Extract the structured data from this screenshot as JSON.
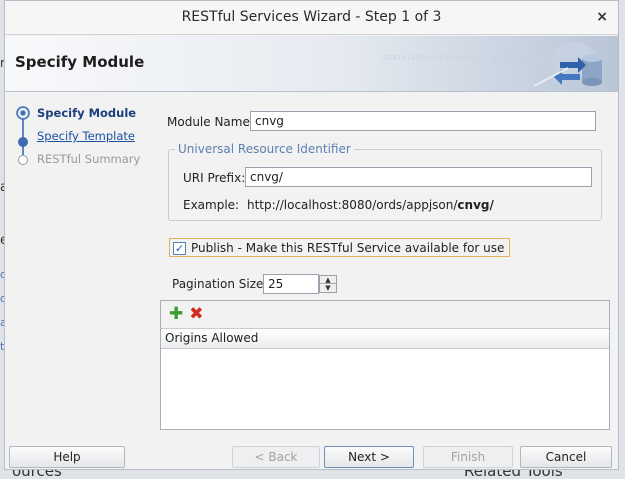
{
  "dialog": {
    "title": "RESTful Services Wizard - Step 1 of 3",
    "close_glyph": "×",
    "header_title": "Specify Module",
    "header_binary": "0101010101010101010101 01010101010"
  },
  "nav": {
    "steps": [
      {
        "label": "Specify Module",
        "state": "active"
      },
      {
        "label": "Specify Template",
        "state": "link"
      },
      {
        "label": "RESTful Summary",
        "state": "disabled"
      }
    ]
  },
  "form": {
    "module_name_label": "Module Name:",
    "module_name_value": "cnvg",
    "uri_group_label": "Universal Resource Identifier",
    "uri_prefix_label": "URI Prefix:",
    "uri_prefix_value": "cnvg/",
    "example_label": "Example:",
    "example_prefix": "http://localhost:8080/ords/appjson/",
    "example_module": "cnvg/",
    "publish_label": "Publish - Make this RESTful Service available for use",
    "publish_checked": true,
    "pagination_label": "Pagination Size:",
    "pagination_value": "25",
    "origins_header": "Origins Allowed"
  },
  "buttons": {
    "help": "Help",
    "back": "< Back",
    "next": "Next >",
    "finish": "Finish",
    "cancel": "Cancel"
  },
  "background": {
    "bottom_left": "ources",
    "bottom_right": "Related Tools"
  },
  "colors": {
    "accent": "#1a4fa0",
    "add_icon": "#3a9d2f",
    "delete_icon": "#d22c1f"
  }
}
